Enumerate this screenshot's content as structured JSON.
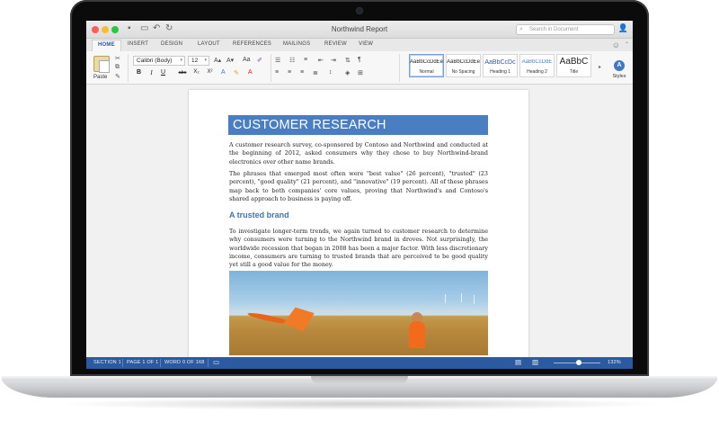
{
  "window": {
    "title": "Northwind Report"
  },
  "search": {
    "placeholder": "Search in Document"
  },
  "tabs": [
    "HOME",
    "INSERT",
    "DESIGN",
    "LAYOUT",
    "REFERENCES",
    "MAILINGS",
    "REVIEW",
    "VIEW"
  ],
  "active_tab": "HOME",
  "ribbon": {
    "paste_label": "Paste",
    "font_name": "Calibri (Body)",
    "font_size": "12",
    "format_buttons": {
      "bold": "B",
      "italic": "I",
      "underline": "U",
      "strike": "abc",
      "subscript": "X₂",
      "superscript": "X²"
    },
    "styles": [
      {
        "sample": "AaBbCcDdEe",
        "name": "Normal"
      },
      {
        "sample": "AaBbCcDdEe",
        "name": "No Spacing"
      },
      {
        "sample": "AaBbCcDc",
        "name": "Heading 1"
      },
      {
        "sample": "AaBbCcDdE",
        "name": "Heading 2"
      },
      {
        "sample": "AaBbC",
        "name": "Title"
      }
    ],
    "styles_pane_label": "Styles"
  },
  "document": {
    "heading": "CUSTOMER RESEARCH",
    "para1": "A customer research survey, co-sponsored by Contoso and Northwind and conducted at the beginning of 2012, asked consumers why they chose to buy Northwind-brand electronics over other name brands.",
    "para2": "The phrases that emerged most often were \"best value\" (26 percent), \"trusted\" (23 percent), \"good quality\" (21 percent), and \"innovative\" (19 percent). All of these phrases map back to both companies' core values, proving that Northwind's and Contoso's shared approach to business is paying off.",
    "subheading": "A trusted brand",
    "para3": "To investigate longer-term trends, we again turned to customer research to determine why consumers were turning to the Northwind brand in droves. Not surprisingly, the worldwide recession that began in 2008 has been a major factor. With less discretionary income, consumers are turning to trusted brands that are perceived to be good quality yet still a good value for the money."
  },
  "statusbar": {
    "section": "SECTION 1",
    "page": "PAGE 1 OF 1",
    "words": "WORD 0 OF 168",
    "zoom": "132%"
  },
  "colors": {
    "accent_blue": "#2c5aa0",
    "heading_banner": "#4a7ec3",
    "subheading": "#3d73bf"
  }
}
